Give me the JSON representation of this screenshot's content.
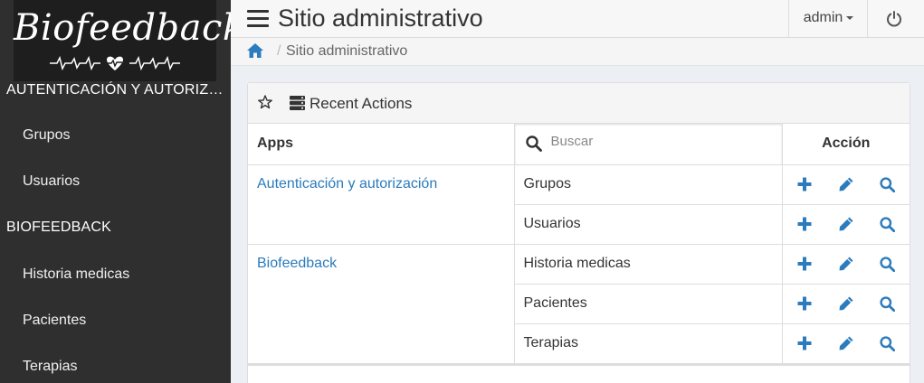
{
  "brand": {
    "title": "Biofeedback"
  },
  "topbar": {
    "title": "Sitio administrativo",
    "user": "admin"
  },
  "breadcrumb": {
    "separator": "/",
    "current": "Sitio administrativo"
  },
  "sidebar": {
    "sections": [
      {
        "label": "AUTENTICACIÓN Y AUTORIZACIÓN",
        "items": [
          {
            "label": "Grupos"
          },
          {
            "label": "Usuarios"
          }
        ]
      },
      {
        "label": "BIOFEEDBACK",
        "items": [
          {
            "label": "Historia medicas"
          },
          {
            "label": "Pacientes"
          },
          {
            "label": "Terapias"
          }
        ]
      }
    ]
  },
  "panel": {
    "title": "Recent Actions",
    "columns": {
      "apps": "Apps",
      "action": "Acción"
    },
    "search_placeholder": "Buscar",
    "apps": [
      {
        "name": "Autenticación y autorización",
        "models": [
          "Grupos",
          "Usuarios"
        ]
      },
      {
        "name": "Biofeedback",
        "models": [
          "Historia medicas",
          "Pacientes",
          "Terapias"
        ]
      }
    ]
  },
  "icons": {
    "add": "plus-icon",
    "edit": "pencil-icon",
    "view": "search-icon"
  },
  "colors": {
    "accent": "#2b7bbd",
    "sidebar": "#2f2f2f",
    "brand_bg": "#1e1e1e"
  }
}
